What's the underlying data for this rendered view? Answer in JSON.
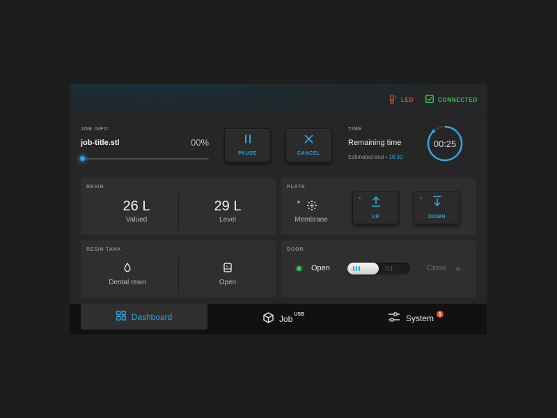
{
  "header": {
    "led_label": "LED",
    "connected_label": "CONNECTED",
    "led_color": "#e2562a",
    "connected_color": "#35c55c",
    "icons": [
      "thermometer-icon",
      "checkbox-checked-icon"
    ]
  },
  "job": {
    "section_label": "JOB INFO",
    "title": "job-title.stl",
    "progress_text": "00%",
    "progress": 0
  },
  "controls": {
    "pause_label": "PAUSE",
    "cancel_label": "CANCEL"
  },
  "time": {
    "section_label": "TIME",
    "remaining_label": "Remaining time",
    "estimated_prefix": "Estimated end •",
    "estimated_value": "18:30",
    "timer": "00:25",
    "timer_progress": 0.88
  },
  "resin": {
    "section_label": "RESIN",
    "valued_value": "26 L",
    "valued_label": "Valued",
    "level_value": "29 L",
    "level_label": "Level"
  },
  "plate": {
    "section_label": "PLATE",
    "membrane_label": "Membrane",
    "up_label": "UP",
    "down_label": "DOWN"
  },
  "resin_tank": {
    "section_label": "RESIN TANK",
    "type_label": "Dental resin",
    "state_label": "Open"
  },
  "door": {
    "section_label": "DOOR",
    "open_label": "Open",
    "close_label": "Close",
    "state": "open"
  },
  "nav": {
    "dashboard_label": "Dashboard",
    "job_label": "Job",
    "job_sup": "USB",
    "system_label": "System",
    "system_badge": "1"
  },
  "colors": {
    "accent": "#29a9e0",
    "warning": "#e2562a",
    "ok": "#35c55c"
  }
}
